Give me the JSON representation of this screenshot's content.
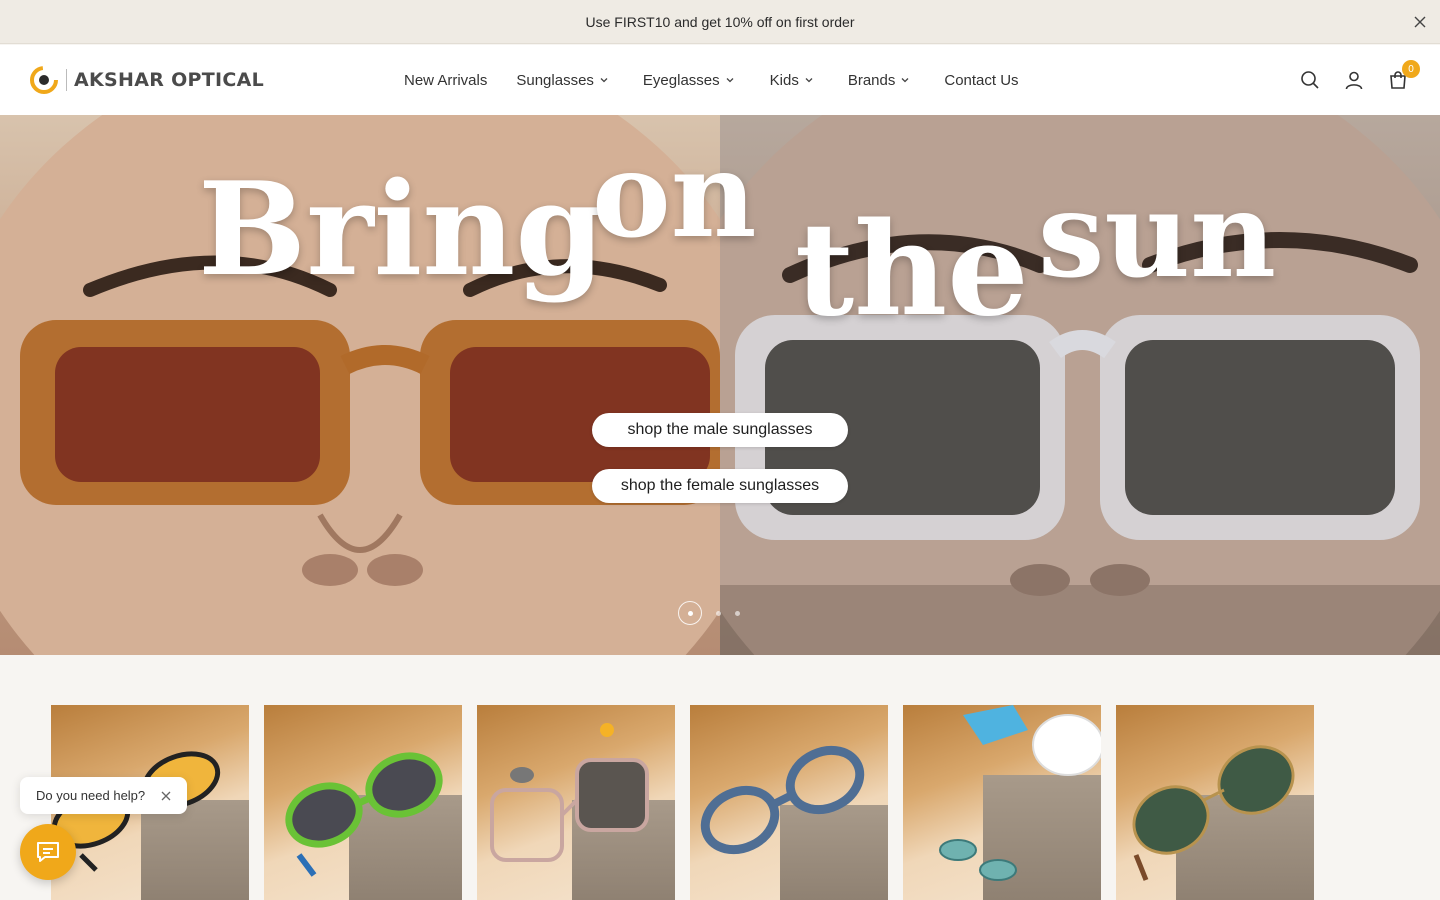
{
  "announcement": {
    "text": "Use FIRST10 and get 10% off on first order",
    "close_icon": "close-icon"
  },
  "header": {
    "logo_text": "AKSHAR OPTICAL",
    "nav": [
      {
        "label": "New Arrivals",
        "dropdown": false
      },
      {
        "label": "Sunglasses",
        "dropdown": true
      },
      {
        "label": "Eyeglasses",
        "dropdown": true
      },
      {
        "label": "Kids",
        "dropdown": true
      },
      {
        "label": "Brands",
        "dropdown": true
      },
      {
        "label": "Contact Us",
        "dropdown": false
      }
    ],
    "icons": [
      "search-icon",
      "account-icon",
      "cart-icon"
    ],
    "cart_count": "0"
  },
  "hero": {
    "words": [
      "Bring",
      "on",
      "the",
      "sun"
    ],
    "buttons": [
      {
        "label": "shop the male sunglasses"
      },
      {
        "label": "shop the female sunglasses"
      }
    ],
    "slide_count": 3,
    "active_slide": 1
  },
  "categories": {
    "count": 6
  },
  "chat": {
    "help_text": "Do you need help?",
    "button_icon": "chat-icon"
  },
  "colors": {
    "accent": "#f0a81a",
    "announcement_bg": "#efebe4"
  }
}
